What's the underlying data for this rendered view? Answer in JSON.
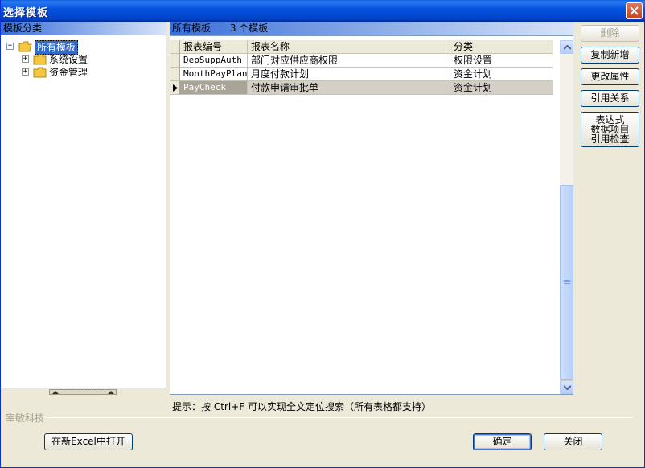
{
  "window": {
    "title": "选择模板"
  },
  "tree": {
    "header": "模板分类",
    "items": [
      {
        "label": "所有模板",
        "expander": "−",
        "selected": true
      },
      {
        "label": "系统设置",
        "expander": "+"
      },
      {
        "label": "资金管理",
        "expander": "+"
      }
    ]
  },
  "grid": {
    "header_title": "所有模板",
    "header_count": "3 个模板",
    "columns": [
      "报表编号",
      "报表名称",
      "分类"
    ],
    "rows": [
      {
        "code": "DepSuppAuth",
        "name": "部门对应供应商权限",
        "category": "权限设置"
      },
      {
        "code": "MonthPayPlan",
        "name": "月度付款计划",
        "category": "资金计划"
      },
      {
        "code": "PayCheck",
        "name": "付款申请审批单",
        "category": "资金计划"
      }
    ],
    "selected_row": 2
  },
  "side_buttons": {
    "delete": "删除",
    "copy_new": "复制新增",
    "change_props": "更改属性",
    "references": "引用关系",
    "expr_check_1": "表达式",
    "expr_check_2": "数据项目",
    "expr_check_3": "引用检查"
  },
  "hint": "提示：按 Ctrl+F 可以实现全文定位搜索（所有表格都支持）",
  "brand": "宰敏科技",
  "footer": {
    "open_excel": "在新Excel中打开",
    "ok": "确定",
    "close": "关闭"
  },
  "colors": {
    "titlebar": "#0454e0",
    "selection": "#316ac5",
    "folder": "#f5c640"
  },
  "icons": {
    "close": "close-icon",
    "folder": "folder-icon",
    "row_pointer": "row-pointer-icon"
  }
}
